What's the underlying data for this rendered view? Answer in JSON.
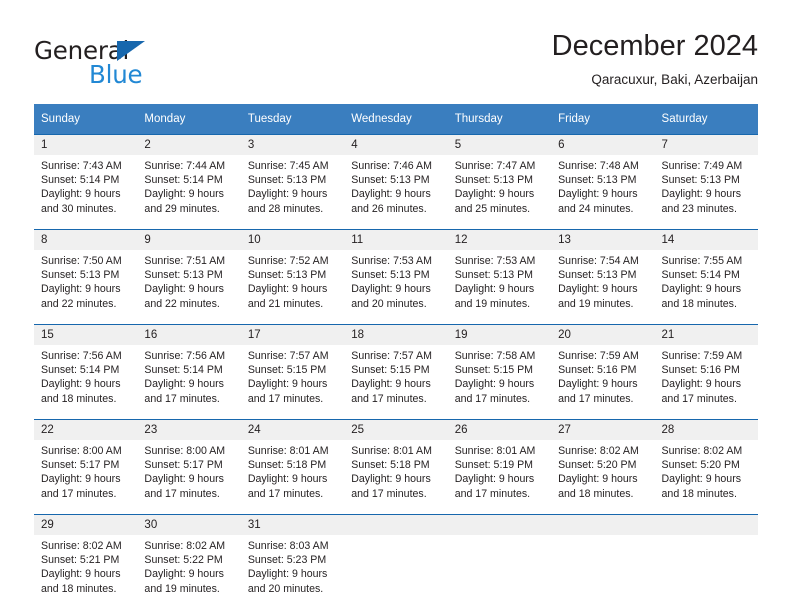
{
  "logo": {
    "word1": "General",
    "word2": "Blue",
    "triangle_color": "#1767ad",
    "word2_color": "#2288d4"
  },
  "header": {
    "title": "December 2024",
    "location": "Qaracuxur, Baki, Azerbaijan"
  },
  "theme": {
    "header_blue": "#3a7ebf",
    "rule_blue": "#1767ad",
    "daynum_band": "#f0f0f0",
    "text": "#231f20"
  },
  "weekday_headers": [
    "Sunday",
    "Monday",
    "Tuesday",
    "Wednesday",
    "Thursday",
    "Friday",
    "Saturday"
  ],
  "weeks": [
    [
      {
        "day": "1",
        "sunrise": "Sunrise: 7:43 AM",
        "sunset": "Sunset: 5:14 PM",
        "daylight1": "Daylight: 9 hours",
        "daylight2": "and 30 minutes."
      },
      {
        "day": "2",
        "sunrise": "Sunrise: 7:44 AM",
        "sunset": "Sunset: 5:14 PM",
        "daylight1": "Daylight: 9 hours",
        "daylight2": "and 29 minutes."
      },
      {
        "day": "3",
        "sunrise": "Sunrise: 7:45 AM",
        "sunset": "Sunset: 5:13 PM",
        "daylight1": "Daylight: 9 hours",
        "daylight2": "and 28 minutes."
      },
      {
        "day": "4",
        "sunrise": "Sunrise: 7:46 AM",
        "sunset": "Sunset: 5:13 PM",
        "daylight1": "Daylight: 9 hours",
        "daylight2": "and 26 minutes."
      },
      {
        "day": "5",
        "sunrise": "Sunrise: 7:47 AM",
        "sunset": "Sunset: 5:13 PM",
        "daylight1": "Daylight: 9 hours",
        "daylight2": "and 25 minutes."
      },
      {
        "day": "6",
        "sunrise": "Sunrise: 7:48 AM",
        "sunset": "Sunset: 5:13 PM",
        "daylight1": "Daylight: 9 hours",
        "daylight2": "and 24 minutes."
      },
      {
        "day": "7",
        "sunrise": "Sunrise: 7:49 AM",
        "sunset": "Sunset: 5:13 PM",
        "daylight1": "Daylight: 9 hours",
        "daylight2": "and 23 minutes."
      }
    ],
    [
      {
        "day": "8",
        "sunrise": "Sunrise: 7:50 AM",
        "sunset": "Sunset: 5:13 PM",
        "daylight1": "Daylight: 9 hours",
        "daylight2": "and 22 minutes."
      },
      {
        "day": "9",
        "sunrise": "Sunrise: 7:51 AM",
        "sunset": "Sunset: 5:13 PM",
        "daylight1": "Daylight: 9 hours",
        "daylight2": "and 22 minutes."
      },
      {
        "day": "10",
        "sunrise": "Sunrise: 7:52 AM",
        "sunset": "Sunset: 5:13 PM",
        "daylight1": "Daylight: 9 hours",
        "daylight2": "and 21 minutes."
      },
      {
        "day": "11",
        "sunrise": "Sunrise: 7:53 AM",
        "sunset": "Sunset: 5:13 PM",
        "daylight1": "Daylight: 9 hours",
        "daylight2": "and 20 minutes."
      },
      {
        "day": "12",
        "sunrise": "Sunrise: 7:53 AM",
        "sunset": "Sunset: 5:13 PM",
        "daylight1": "Daylight: 9 hours",
        "daylight2": "and 19 minutes."
      },
      {
        "day": "13",
        "sunrise": "Sunrise: 7:54 AM",
        "sunset": "Sunset: 5:13 PM",
        "daylight1": "Daylight: 9 hours",
        "daylight2": "and 19 minutes."
      },
      {
        "day": "14",
        "sunrise": "Sunrise: 7:55 AM",
        "sunset": "Sunset: 5:14 PM",
        "daylight1": "Daylight: 9 hours",
        "daylight2": "and 18 minutes."
      }
    ],
    [
      {
        "day": "15",
        "sunrise": "Sunrise: 7:56 AM",
        "sunset": "Sunset: 5:14 PM",
        "daylight1": "Daylight: 9 hours",
        "daylight2": "and 18 minutes."
      },
      {
        "day": "16",
        "sunrise": "Sunrise: 7:56 AM",
        "sunset": "Sunset: 5:14 PM",
        "daylight1": "Daylight: 9 hours",
        "daylight2": "and 17 minutes."
      },
      {
        "day": "17",
        "sunrise": "Sunrise: 7:57 AM",
        "sunset": "Sunset: 5:15 PM",
        "daylight1": "Daylight: 9 hours",
        "daylight2": "and 17 minutes."
      },
      {
        "day": "18",
        "sunrise": "Sunrise: 7:57 AM",
        "sunset": "Sunset: 5:15 PM",
        "daylight1": "Daylight: 9 hours",
        "daylight2": "and 17 minutes."
      },
      {
        "day": "19",
        "sunrise": "Sunrise: 7:58 AM",
        "sunset": "Sunset: 5:15 PM",
        "daylight1": "Daylight: 9 hours",
        "daylight2": "and 17 minutes."
      },
      {
        "day": "20",
        "sunrise": "Sunrise: 7:59 AM",
        "sunset": "Sunset: 5:16 PM",
        "daylight1": "Daylight: 9 hours",
        "daylight2": "and 17 minutes."
      },
      {
        "day": "21",
        "sunrise": "Sunrise: 7:59 AM",
        "sunset": "Sunset: 5:16 PM",
        "daylight1": "Daylight: 9 hours",
        "daylight2": "and 17 minutes."
      }
    ],
    [
      {
        "day": "22",
        "sunrise": "Sunrise: 8:00 AM",
        "sunset": "Sunset: 5:17 PM",
        "daylight1": "Daylight: 9 hours",
        "daylight2": "and 17 minutes."
      },
      {
        "day": "23",
        "sunrise": "Sunrise: 8:00 AM",
        "sunset": "Sunset: 5:17 PM",
        "daylight1": "Daylight: 9 hours",
        "daylight2": "and 17 minutes."
      },
      {
        "day": "24",
        "sunrise": "Sunrise: 8:01 AM",
        "sunset": "Sunset: 5:18 PM",
        "daylight1": "Daylight: 9 hours",
        "daylight2": "and 17 minutes."
      },
      {
        "day": "25",
        "sunrise": "Sunrise: 8:01 AM",
        "sunset": "Sunset: 5:18 PM",
        "daylight1": "Daylight: 9 hours",
        "daylight2": "and 17 minutes."
      },
      {
        "day": "26",
        "sunrise": "Sunrise: 8:01 AM",
        "sunset": "Sunset: 5:19 PM",
        "daylight1": "Daylight: 9 hours",
        "daylight2": "and 17 minutes."
      },
      {
        "day": "27",
        "sunrise": "Sunrise: 8:02 AM",
        "sunset": "Sunset: 5:20 PM",
        "daylight1": "Daylight: 9 hours",
        "daylight2": "and 18 minutes."
      },
      {
        "day": "28",
        "sunrise": "Sunrise: 8:02 AM",
        "sunset": "Sunset: 5:20 PM",
        "daylight1": "Daylight: 9 hours",
        "daylight2": "and 18 minutes."
      }
    ],
    [
      {
        "day": "29",
        "sunrise": "Sunrise: 8:02 AM",
        "sunset": "Sunset: 5:21 PM",
        "daylight1": "Daylight: 9 hours",
        "daylight2": "and 18 minutes."
      },
      {
        "day": "30",
        "sunrise": "Sunrise: 8:02 AM",
        "sunset": "Sunset: 5:22 PM",
        "daylight1": "Daylight: 9 hours",
        "daylight2": "and 19 minutes."
      },
      {
        "day": "31",
        "sunrise": "Sunrise: 8:03 AM",
        "sunset": "Sunset: 5:23 PM",
        "daylight1": "Daylight: 9 hours",
        "daylight2": "and 20 minutes."
      },
      {
        "day": "",
        "sunrise": "",
        "sunset": "",
        "daylight1": "",
        "daylight2": ""
      },
      {
        "day": "",
        "sunrise": "",
        "sunset": "",
        "daylight1": "",
        "daylight2": ""
      },
      {
        "day": "",
        "sunrise": "",
        "sunset": "",
        "daylight1": "",
        "daylight2": ""
      },
      {
        "day": "",
        "sunrise": "",
        "sunset": "",
        "daylight1": "",
        "daylight2": ""
      }
    ]
  ]
}
